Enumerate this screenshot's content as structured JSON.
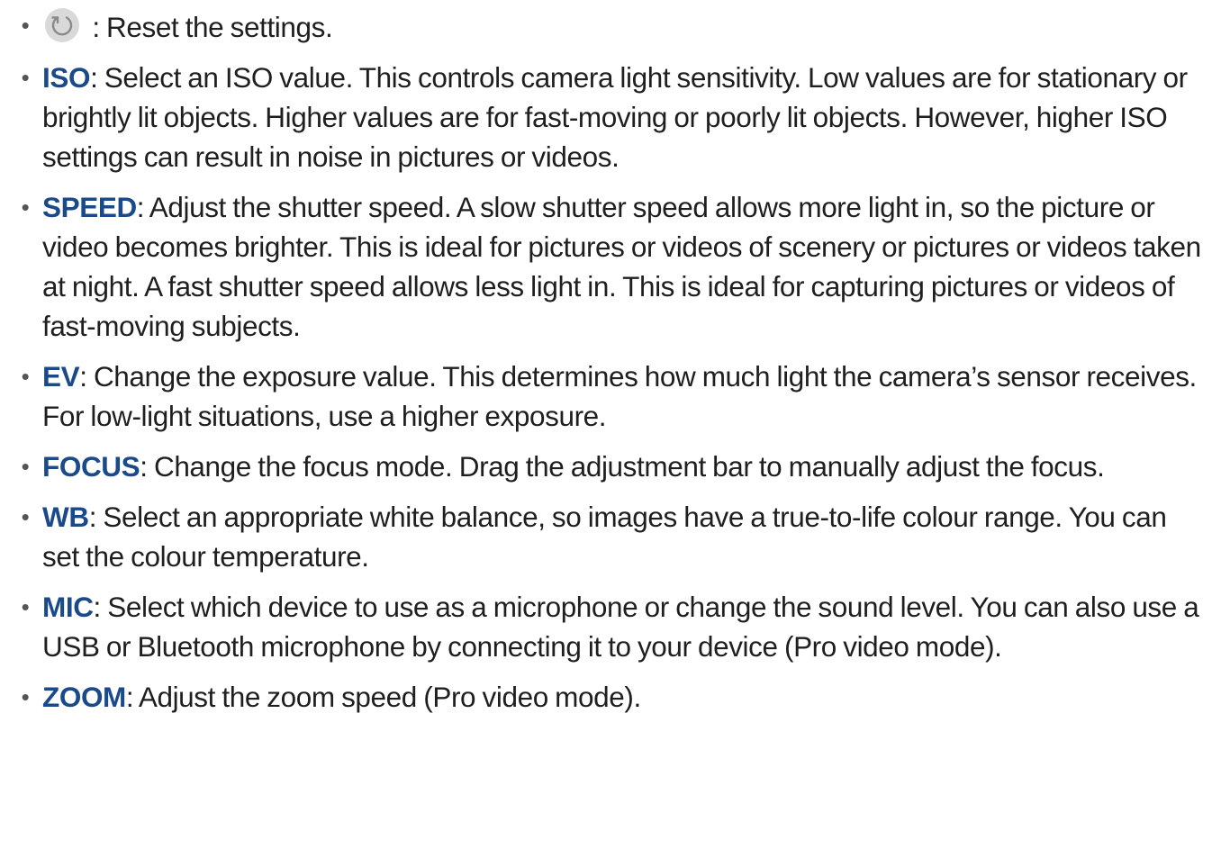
{
  "items": [
    {
      "icon": "reset-icon",
      "term": "",
      "text": " : Reset the settings."
    },
    {
      "term": "ISO",
      "text": ": Select an ISO value. This controls camera light sensitivity. Low values are for stationary or brightly lit objects. Higher values are for fast-moving or poorly lit objects. However, higher ISO settings can result in noise in pictures or videos."
    },
    {
      "term": "SPEED",
      "text": ": Adjust the shutter speed. A slow shutter speed allows more light in, so the picture or video becomes brighter. This is ideal for pictures or videos of scenery or pictures or videos taken at night. A fast shutter speed allows less light in. This is ideal for capturing pictures or videos of fast-moving subjects."
    },
    {
      "term": "EV",
      "text": ": Change the exposure value. This determines how much light the camera’s sensor receives. For low-light situations, use a higher exposure."
    },
    {
      "term": "FOCUS",
      "text": ": Change the focus mode. Drag the adjustment bar to manually adjust the focus."
    },
    {
      "term": "WB",
      "text": ": Select an appropriate white balance, so images have a true-to-life colour range. You can set the colour temperature."
    },
    {
      "term": "MIC",
      "text": ": Select which device to use as a microphone or change the sound level. You can also use a USB or Bluetooth microphone by connecting it to your device (Pro video mode)."
    },
    {
      "term": "ZOOM",
      "text": ": Adjust the zoom speed (Pro video mode)."
    }
  ],
  "colors": {
    "term": "#1a4a8a",
    "body_text": "#1f1f1f"
  }
}
